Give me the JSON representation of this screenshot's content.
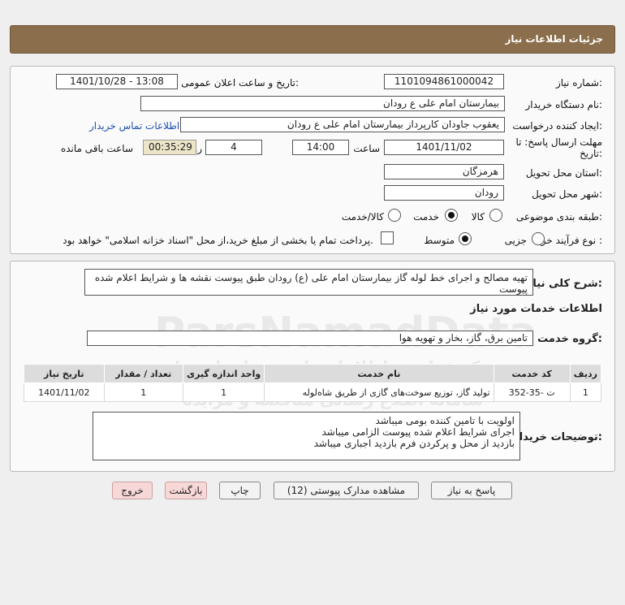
{
  "header": {
    "title": "جزئیات اطلاعات نیاز"
  },
  "form": {
    "need_number_label": "شماره نیاز:",
    "need_number": "1101094861000042",
    "announce_label": "تاریخ و ساعت اعلان عمومی:",
    "announce_value": "1401/10/28 - 13:08",
    "buyer_org_label": "نام دستگاه خریدار:",
    "buyer_org": "بیمارستان امام علی  ع  رودان",
    "creator_label": "ایجاد کننده درخواست:",
    "creator": "یعقوب جاودان کارپرداز بیمارستان امام علی  ع  رودان",
    "contact_link": "اطلاعات تماس خریدار",
    "deadline_label_1": "مهلت ارسال پاسخ: تا",
    "deadline_label_2": "تاریخ:",
    "deadline_date": "1401/11/02",
    "time_label": "ساعت",
    "deadline_time": "14:00",
    "days_value": "4",
    "days_label": "روز و",
    "remaining_value": "00:35:29",
    "remaining_label": "ساعت باقی مانده",
    "province_label": "استان محل تحویل:",
    "province": "هرمزگان",
    "city_label": "شهر محل تحویل:",
    "city": "رودان",
    "category_label": "طبقه بندی موضوعی:",
    "category_options": [
      "کالا",
      "خدمت",
      "کالا/خدمت"
    ],
    "category_selected": "خدمت",
    "process_label": "نوع فرآیند خرید :",
    "process_options": [
      "جزیی",
      "متوسط"
    ],
    "process_selected": "متوسط",
    "treasury_note": "پرداخت تمام یا بخشی از مبلغ خرید،از محل \"اسناد خزانه اسلامی\" خواهد بود."
  },
  "details": {
    "desc_label": "شرح کلی نیاز:",
    "desc_text": "تهیه مصالح و اجرای خط لوله گاز بیمارستان امام علی (ع) رودان طبق پیوست نقشه ها و شرایط اعلام شده پیوست",
    "services_title": "اطلاعات خدمات مورد نیاز",
    "service_group_label": "گروه خدمت:",
    "service_group": "تامین برق، گاز، بخار و تهویه هوا",
    "table": {
      "headers": [
        "ردیف",
        "کد خدمت",
        "نام خدمت",
        "واحد اندازه گیری",
        "تعداد / مقدار",
        "تاریخ نیاز"
      ],
      "rows": [
        [
          "1",
          "ت -35-352",
          "تولید گاز، توزیع سوخت‌های گازی از طریق شاه‌لوله",
          "1",
          "1",
          "1401/11/02"
        ]
      ]
    },
    "buyer_notes_label": "توضیحات خریدار:",
    "buyer_notes": [
      "اولویت با تامین کننده بومی میباشد",
      "اجرای شرایط اعلام شده پیوست الزامی میباشد",
      "بازدید از محل و پرکردن فرم بازدید اجباری میباشد"
    ]
  },
  "buttons": {
    "reply": "پاسخ به نیاز",
    "attachments": "مشاهده مدارک پیوستی (12)",
    "print": "چاپ",
    "back": "بازگشت",
    "exit": "خروج"
  },
  "watermark": {
    "brand": "ParsNamadData",
    "phone": "۰۲۱-۸۸۳۴۹۶۷۰",
    "line1": "مرکز فراوری اطلاعات پارس نماد داده ها",
    "line2": "سامانه اطلاع رسانی مناقصه و مزایده"
  }
}
